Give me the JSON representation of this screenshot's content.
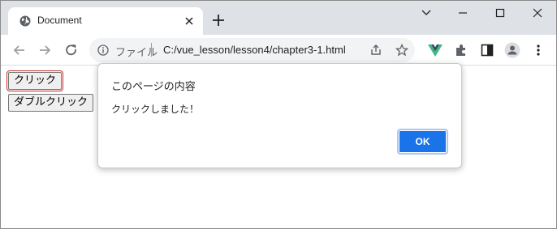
{
  "browser": {
    "tab": {
      "title": "Document"
    },
    "address_bar": {
      "scheme_label": "ファイル",
      "url": "C:/vue_lesson/lesson4/chapter3-1.html"
    },
    "icons": {
      "tab_favicon": "globe-icon",
      "back": "arrow-left-icon",
      "forward": "arrow-right-icon",
      "reload": "reload-icon",
      "share": "share-icon",
      "bookmark": "star-icon",
      "vue_extension": "vue-logo-icon",
      "extensions": "puzzle-icon",
      "side_panel": "side-panel-icon",
      "profile": "profile-icon",
      "menu": "kebab-menu-icon"
    },
    "colors": {
      "tabstrip_bg": "#dee1e6",
      "omnibox_bg": "#f1f3f4",
      "ok_button": "#1a73e8",
      "vue_green": "#41b883",
      "vue_dark": "#35495e"
    }
  },
  "page": {
    "click_button_label": "クリック",
    "double_click_button_label": "ダブルクリック"
  },
  "dialog": {
    "title": "このページの内容",
    "message": "クリックしました！",
    "ok_label": "OK"
  }
}
